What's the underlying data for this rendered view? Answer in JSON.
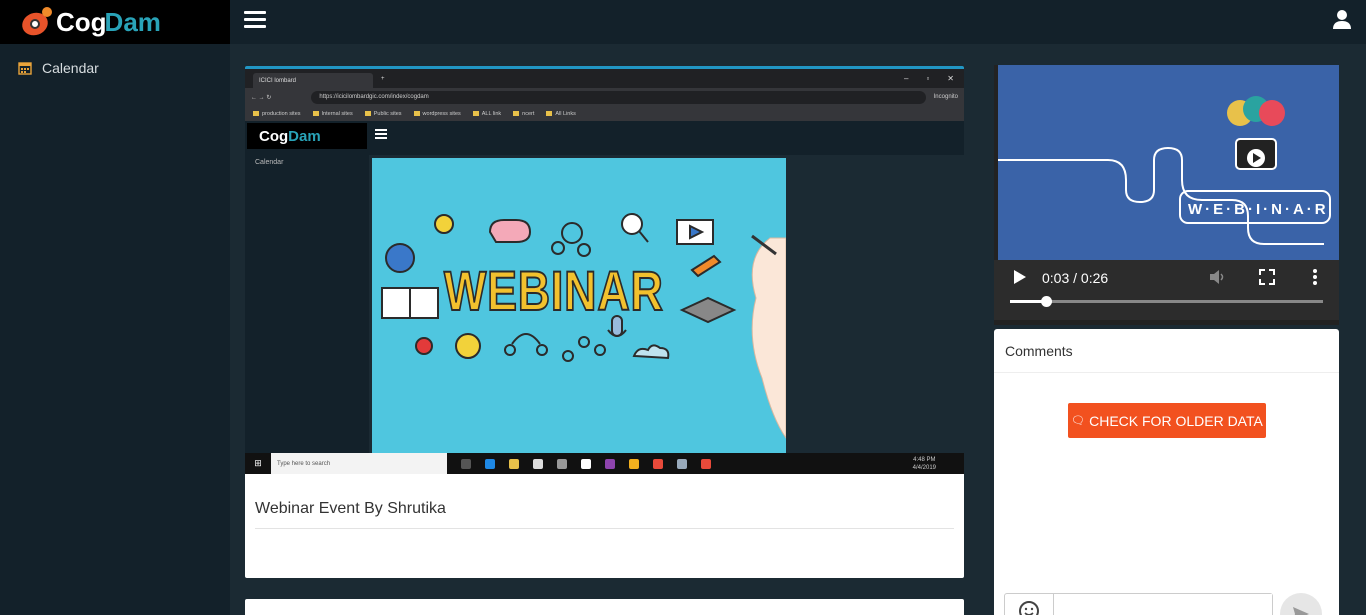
{
  "brand": {
    "part1": "Cog",
    "part2": "Dam"
  },
  "sidebar": {
    "items": [
      {
        "label": "Calendar",
        "icon": "calendar-icon"
      }
    ]
  },
  "topbar": {
    "menu_icon": "hamburger-icon",
    "user_icon": "user-icon"
  },
  "event": {
    "title": "Webinar Event By Shrutika",
    "embedded_screenshot": {
      "tab_title": "ICICI lombard",
      "url": "https://icicilombardgic.com/index/cogdam",
      "incognito_label": "Incognito",
      "bookmarks": [
        "production sites",
        "Internal sites",
        "Public sites",
        "wordpress sites",
        "ALL link",
        "ncert",
        "All Links"
      ],
      "inner_brand": {
        "part1": "Cog",
        "part2": "Dam"
      },
      "inner_sidebar_item": "Calendar",
      "slide_text": "WEBINAR",
      "taskbar_search": "Type here to search",
      "clock_time": "4:48 PM",
      "clock_date": "4/4/2019"
    }
  },
  "player": {
    "poster_text": "W·E·B·I·N·A·R",
    "time": "0:03 / 0:26",
    "progress": 0.115
  },
  "comments": {
    "header": "Comments",
    "older_button": "CHECK FOR OLDER DATA",
    "input_placeholder": ""
  },
  "colors": {
    "accent": "#2196c4",
    "button": "#f2511f",
    "poster_bg": "#3a63a8",
    "sidebar": "#13212a"
  }
}
